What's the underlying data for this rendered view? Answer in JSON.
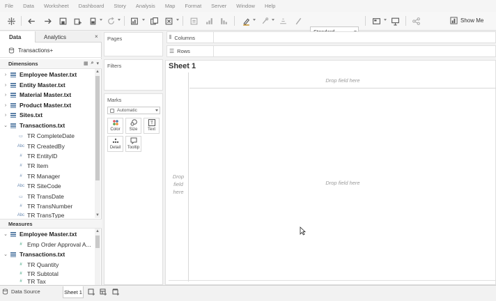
{
  "menu": [
    "File",
    "Data",
    "Worksheet",
    "Dashboard",
    "Story",
    "Analysis",
    "Map",
    "Format",
    "Server",
    "Window",
    "Help"
  ],
  "toolbar": {
    "fit_value": "Standard",
    "show_me_label": "Show Me"
  },
  "datapane": {
    "tabs": {
      "data": "Data",
      "analytics": "Analytics",
      "close": "×"
    },
    "datasource": "Transactions+",
    "dimensions_label": "Dimensions",
    "dimension_tables": [
      "Employee Master.txt",
      "Entity Master.txt",
      "Material Master.txt",
      "Product Master.txt",
      "Sites.txt",
      "Transactions.txt"
    ],
    "dimension_fields": [
      {
        "type": "date",
        "type_label": "▭",
        "name": "TR CompleteDate"
      },
      {
        "type": "string",
        "type_label": "Abc",
        "name": "TR CreatedBy"
      },
      {
        "type": "number",
        "type_label": "#",
        "name": "TR EntityID"
      },
      {
        "type": "number",
        "type_label": "#",
        "name": "TR Item"
      },
      {
        "type": "number",
        "type_label": "#",
        "name": "TR Manager"
      },
      {
        "type": "string",
        "type_label": "Abc",
        "name": "TR SiteCode"
      },
      {
        "type": "date",
        "type_label": "▭",
        "name": "TR TransDate"
      },
      {
        "type": "number",
        "type_label": "#",
        "name": "TR TransNumber"
      },
      {
        "type": "string",
        "type_label": "Abc",
        "name": "TR TransType"
      }
    ],
    "measures_label": "Measures",
    "measure_tables": [
      "Employee Master.txt",
      "Transactions.txt"
    ],
    "measure_fields_employee": [
      {
        "type_label": "#",
        "name": "Emp Order Approval A..."
      }
    ],
    "measure_fields_transactions": [
      {
        "type_label": "#",
        "name": "TR Quantity"
      },
      {
        "type_label": "#",
        "name": "TR Subtotal"
      },
      {
        "type_label": "#",
        "name": "TR Tax"
      }
    ]
  },
  "cards": {
    "pages": "Pages",
    "filters": "Filters",
    "marks": "Marks",
    "marks_type": "Automatic",
    "mark_buttons": {
      "color": "Color",
      "size": "Size",
      "text": "Text",
      "detail": "Detail",
      "tooltip": "Tooltip"
    }
  },
  "shelves": {
    "columns": "Columns",
    "rows": "Rows"
  },
  "canvas": {
    "sheet_title": "Sheet 1",
    "drop_top": "Drop field here",
    "drop_left_1": "Drop",
    "drop_left_2": "field",
    "drop_left_3": "here",
    "drop_center": "Drop field here"
  },
  "bottom": {
    "data_source_tab": "Data Source",
    "sheet_tab": "Sheet 1"
  },
  "colors": {
    "accent_blue": "#5a7fa6",
    "measure_green": "#3aa07a"
  }
}
